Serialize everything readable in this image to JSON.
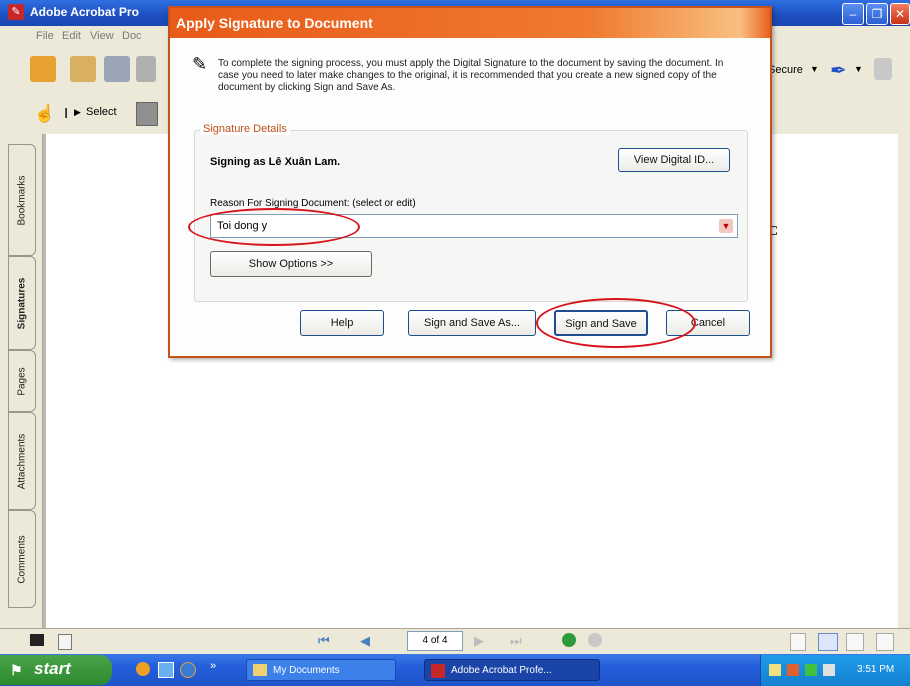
{
  "app": {
    "title": "Adobe Acrobat Pro",
    "menu": [
      "File",
      "Edit",
      "View",
      "Doc"
    ],
    "toolbar": {
      "secure_label": "Secure",
      "select_label": "Select"
    },
    "nav_tabs": [
      "Bookmarks",
      "Signatures",
      "Pages",
      "Attachments",
      "Comments"
    ],
    "page_indicator": "4 of 4",
    "doc_fragment": "C"
  },
  "dialog": {
    "title": "Apply Signature to Document",
    "instructions": "To complete the signing process, you must apply the Digital Signature to the document by saving the document. In case you need to later make changes to the original, it is recommended that you create a new signed copy of the document by clicking Sign and Save As.",
    "group_label": "Signature Details",
    "signing_as": "Signing as Lê Xuân Lam.",
    "view_id_button": "View Digital ID...",
    "reason_label": "Reason For Signing Document: (select or edit)",
    "reason_value": "Toi dong y",
    "show_options_button": "Show Options >>",
    "help_button": "Help",
    "sign_save_as_button": "Sign and Save As...",
    "sign_save_button": "Sign and Save",
    "cancel_button": "Cancel"
  },
  "taskbar": {
    "start_label": "start",
    "items": [
      "My Documents",
      "Adobe Acrobat Profe..."
    ],
    "clock": "3:51 PM"
  },
  "colors": {
    "dialog_title": "#e85a18",
    "highlight_ellipse": "#d8121a",
    "taskbar": "#245edb"
  }
}
